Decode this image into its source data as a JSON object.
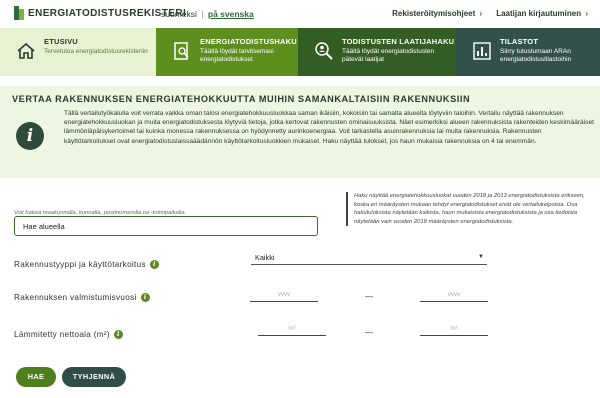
{
  "header": {
    "logo_text": "ENERGIATODISTUSREKISTERI",
    "lang_fi": "suomeksi",
    "lang_separator": "|",
    "lang_sv": "på svenska",
    "link_register": "Rekisteröitymisohjeet",
    "link_login": "Laatijan kirjautuminen"
  },
  "nav": [
    {
      "title": "ETUSIVU",
      "sub": "Tervetuloa energiatodistusrekisteriin",
      "icon": "home-icon"
    },
    {
      "title": "ENERGIATODISTUSHAKU",
      "sub": "Täältä löydät tarvitsemasi energiatodistukset",
      "icon": "document-search-icon"
    },
    {
      "title": "TODISTUSTEN LAATIJAHAKU",
      "sub": "Täältä löydät energiatodistusten pätevät laatijat",
      "icon": "person-search-icon"
    },
    {
      "title": "TILASTOT",
      "sub": "Siirry tutustumaan ARAn energiatodistustilastoihin",
      "icon": "statistics-icon"
    }
  ],
  "info": {
    "heading": "VERTAA RAKENNUKSEN ENERGIATEHOKKUUTTA MUIHIN SAMANKALTAISIIN RAKENNUKSIIN",
    "icon": "info-icon",
    "body": "Tällä vertailutyökalulla voit verrata vaikka oman talosi energiatehokkuusluokkaa saman ikäisiin, kokoisiin tai samalta alueelta löytyviin taloihin. Vertailu näyttää rakennuksen energiatehokkuusluokan ja muita energiatodistuksesta löytyviä tietoja, jotka kertovat rakennusten ominaisuuksista. Näet esimerkiksi alueen rakennuksista rakenteiden keskimääräiset lämmönläpäisykertoimet tai kuinka monessa rakennuksessa on hyödynnetty aurinkoenergiaa. Voit tarkastella asuinrakennuksia tai muita rakennuksia. Rakennusten käyttötarkoitukset ovat energiatodistuslaissaäädännön käyttötarkoitusluokkien mukaiset. Haku näyttää tulokset, jos haun mukaisia rakennuksia on 4 tai enemmän."
  },
  "search": {
    "hint": "Voit hakea maakunnalla, kunnalla, postinumerolla tai -toimipaikalla.",
    "value": "Hae alueella"
  },
  "note": "Haku näyttää energiatehokkuusluokat vuoden 2018 ja 2013 energiatodistuksista erikseen, koska eri määräysten mukaan tehdyt energiatodistukset eivät ole vertailukelpoisia. Osa hakutuloksista näytetään kaikista, haun mukaisista energiatodistuksista ja osa tiedoista näytetään vain vuoden 2018 määräysten energiatodistuksista.",
  "filters": {
    "type_label": "Rakennustyyppi ja käyttötarkoitus",
    "type_value": "Kaikki",
    "year_label": "Rakennuksen valmistumisvuosi",
    "year_placeholder_from": "vvvv",
    "year_placeholder_to": "vvvv",
    "area_label": "Lämmitetty nettoala (m²)",
    "area_placeholder_from": "m²",
    "area_placeholder_to": "m²",
    "range_dash": "—",
    "info_glyph": "i"
  },
  "buttons": {
    "search": "HAE",
    "clear": "TYHJENNÄ"
  },
  "colors": {
    "accent_green": "#5d8e1e",
    "dark_green": "#345d23",
    "teal": "#31514a",
    "light_green_bg": "#eef6e2"
  }
}
